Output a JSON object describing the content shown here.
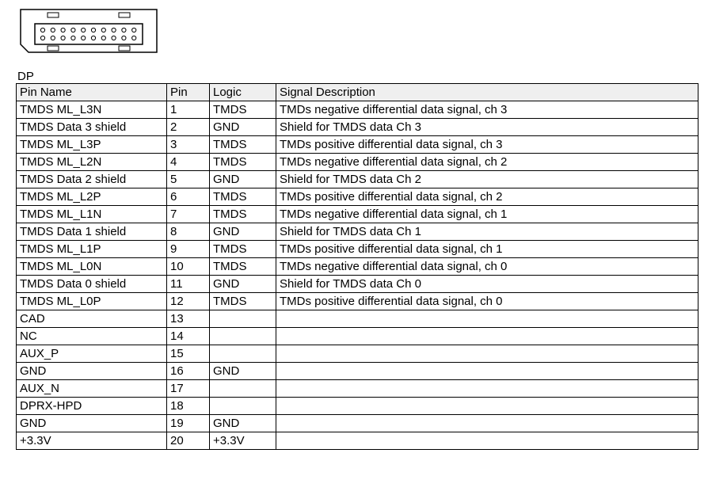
{
  "connector_label": "DP",
  "table": {
    "headers": {
      "pin_name": "Pin Name",
      "pin": "Pin",
      "logic": "Logic",
      "signal_desc": "Signal Description"
    },
    "rows": [
      {
        "pin_name": "TMDS ML_L3N",
        "pin": "1",
        "logic": "TMDS",
        "desc": "TMDs negative differential data signal, ch 3"
      },
      {
        "pin_name": "TMDS Data 3 shield",
        "pin": "2",
        "logic": "GND",
        "desc": "Shield for TMDS data Ch 3"
      },
      {
        "pin_name": "TMDS ML_L3P",
        "pin": "3",
        "logic": "TMDS",
        "desc": "TMDs positive differential data signal, ch 3"
      },
      {
        "pin_name": "TMDS ML_L2N",
        "pin": "4",
        "logic": "TMDS",
        "desc": "TMDs negative differential data signal, ch 2"
      },
      {
        "pin_name": "TMDS Data 2 shield",
        "pin": "5",
        "logic": "GND",
        "desc": "Shield for TMDS data Ch 2"
      },
      {
        "pin_name": "TMDS ML_L2P",
        "pin": "6",
        "logic": "TMDS",
        "desc": "TMDs positive differential data signal, ch 2"
      },
      {
        "pin_name": "TMDS ML_L1N",
        "pin": "7",
        "logic": "TMDS",
        "desc": "TMDs negative differential data signal, ch 1"
      },
      {
        "pin_name": "TMDS Data 1 shield",
        "pin": "8",
        "logic": "GND",
        "desc": "Shield for TMDS data Ch 1"
      },
      {
        "pin_name": "TMDS ML_L1P",
        "pin": "9",
        "logic": "TMDS",
        "desc": "TMDs positive differential data signal, ch 1"
      },
      {
        "pin_name": "TMDS ML_L0N",
        "pin": "10",
        "logic": "TMDS",
        "desc": "TMDs negative differential data signal, ch 0"
      },
      {
        "pin_name": "TMDS Data 0 shield",
        "pin": "11",
        "logic": "GND",
        "desc": "Shield for TMDS data Ch 0"
      },
      {
        "pin_name": "TMDS ML_L0P",
        "pin": "12",
        "logic": "TMDS",
        "desc": "TMDs positive differential data signal, ch 0"
      },
      {
        "pin_name": "CAD",
        "pin": "13",
        "logic": "",
        "desc": ""
      },
      {
        "pin_name": "NC",
        "pin": "14",
        "logic": "",
        "desc": ""
      },
      {
        "pin_name": "AUX_P",
        "pin": "15",
        "logic": "",
        "desc": ""
      },
      {
        "pin_name": "GND",
        "pin": "16",
        "logic": "GND",
        "desc": ""
      },
      {
        "pin_name": "AUX_N",
        "pin": "17",
        "logic": "",
        "desc": ""
      },
      {
        "pin_name": "DPRX-HPD",
        "pin": "18",
        "logic": "",
        "desc": ""
      },
      {
        "pin_name": "GND",
        "pin": "19",
        "logic": "GND",
        "desc": ""
      },
      {
        "pin_name": "+3.3V",
        "pin": "20",
        "logic": "+3.3V",
        "desc": ""
      }
    ]
  }
}
